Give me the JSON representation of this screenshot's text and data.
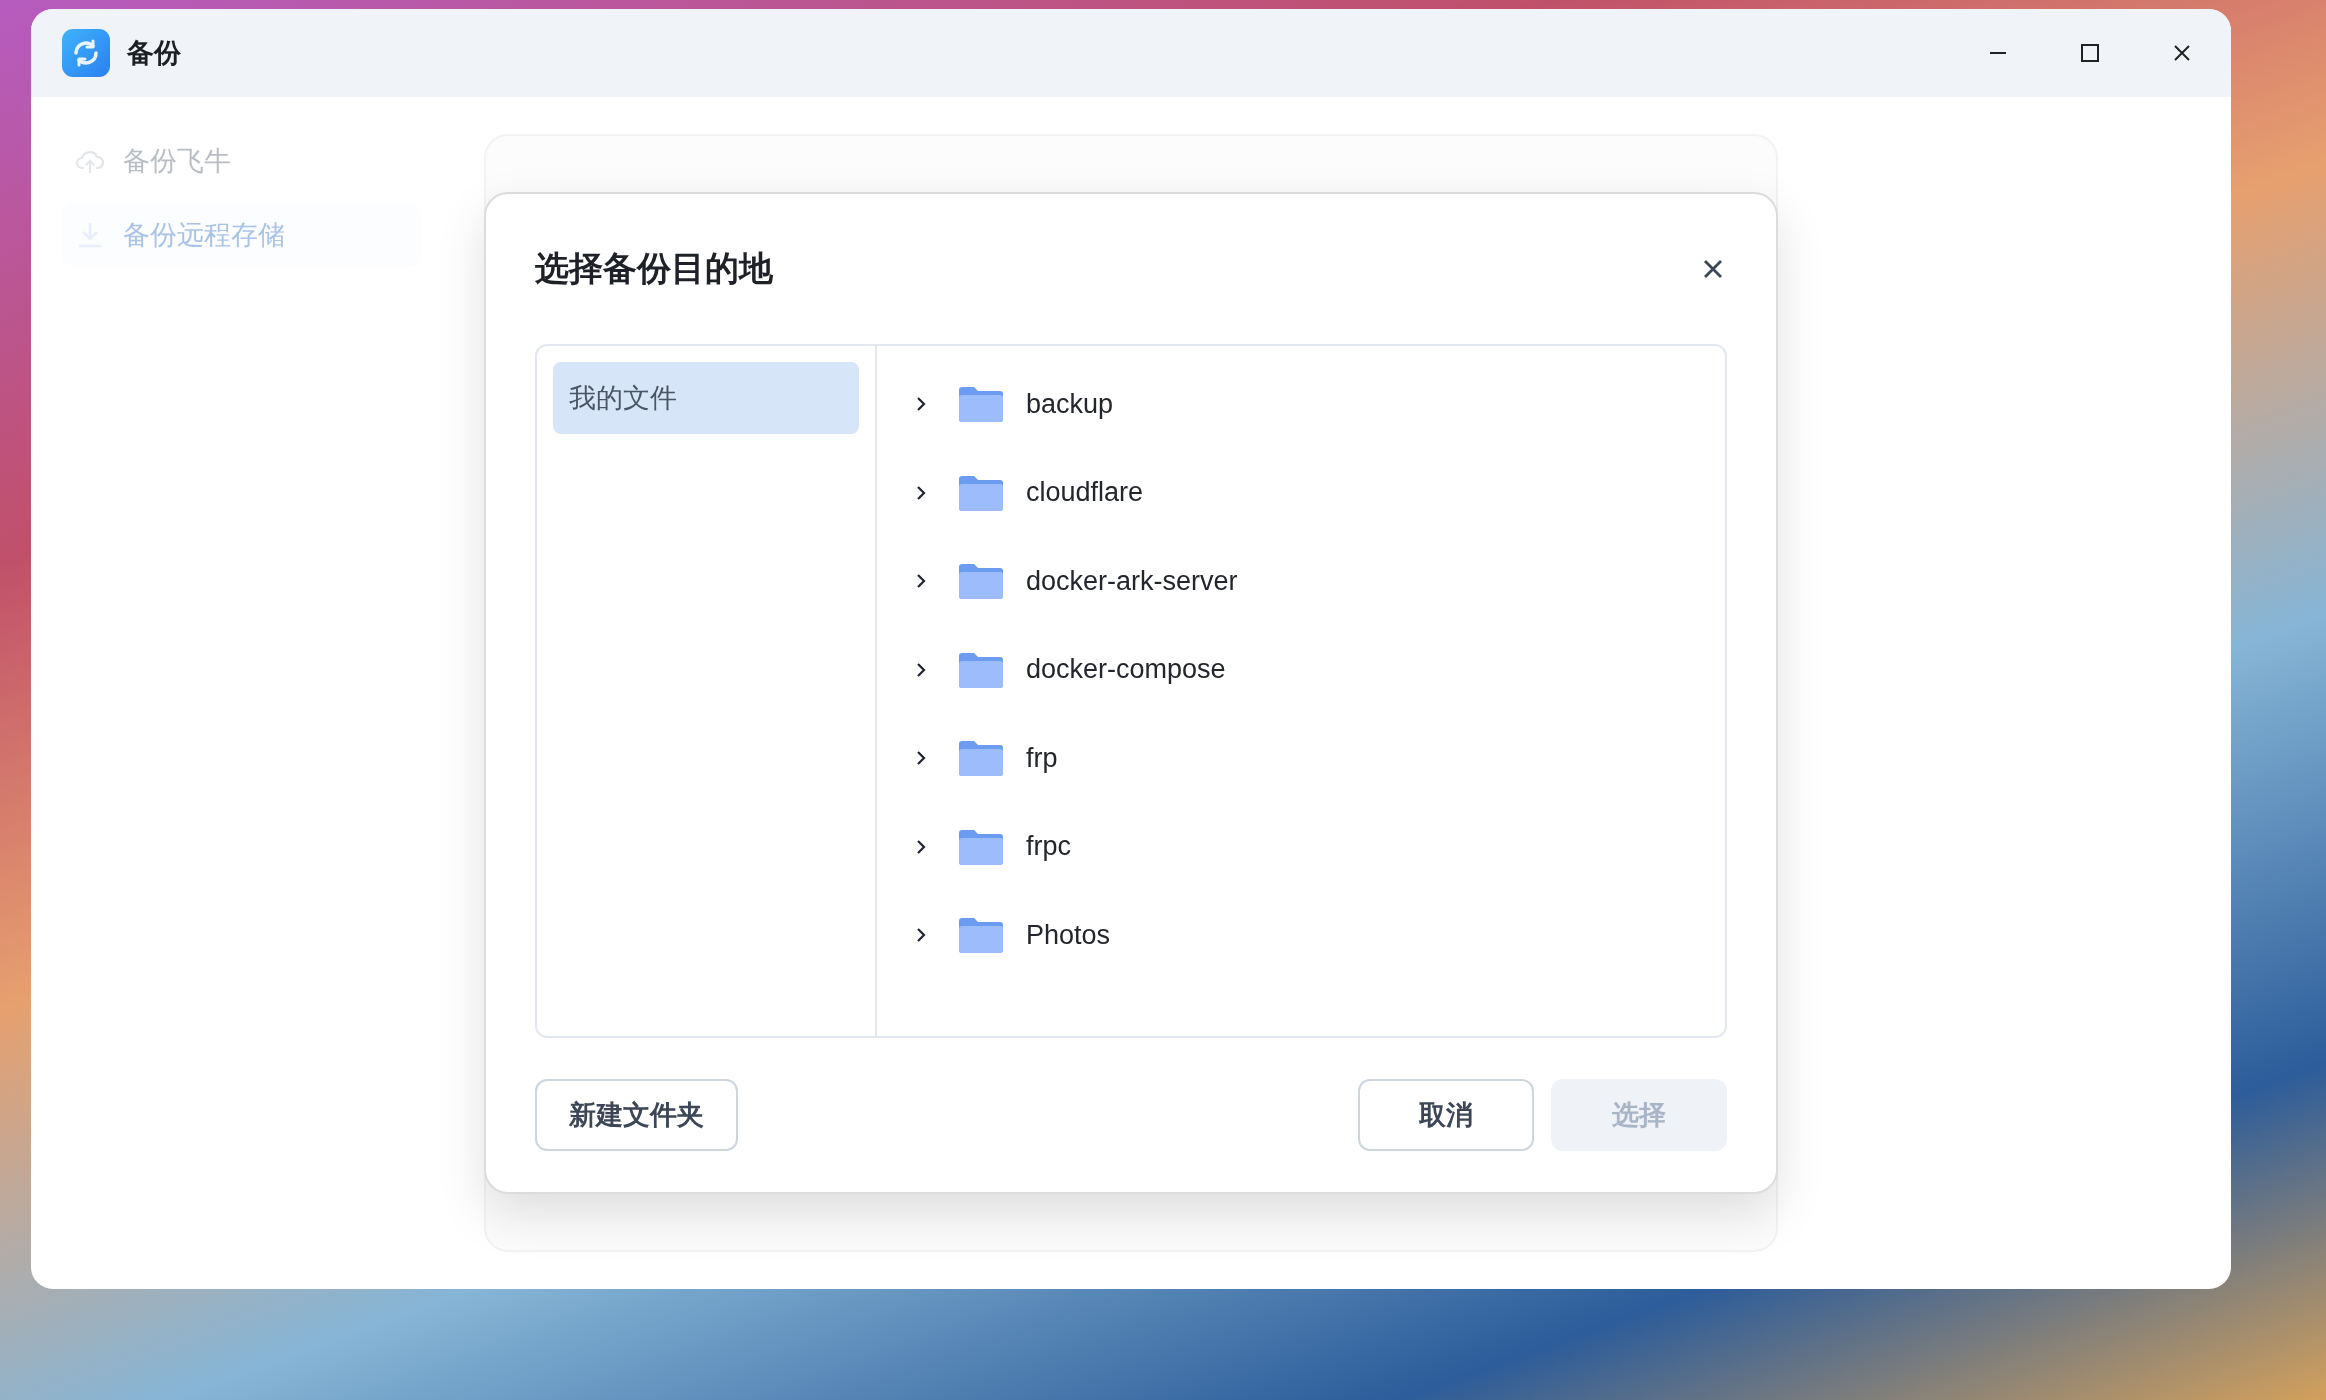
{
  "window": {
    "title": "备份"
  },
  "sidebar": {
    "items": [
      {
        "label": "备份飞牛",
        "selected": false
      },
      {
        "label": "备份远程存储",
        "selected": true
      }
    ]
  },
  "dialog": {
    "title": "选择备份目的地",
    "locations": [
      {
        "label": "我的文件",
        "selected": true
      }
    ],
    "folders": [
      {
        "name": "backup",
        "expanded": false
      },
      {
        "name": "cloudflare",
        "expanded": false
      },
      {
        "name": "docker-ark-server",
        "expanded": false
      },
      {
        "name": "docker-compose",
        "expanded": false
      },
      {
        "name": "frp",
        "expanded": false
      },
      {
        "name": "frpc",
        "expanded": false
      },
      {
        "name": "Photos",
        "expanded": false
      }
    ],
    "buttons": [
      {
        "label": "新建文件夹",
        "kind": "secondary",
        "disabled": false
      },
      {
        "label": "取消",
        "kind": "secondary",
        "disabled": false
      },
      {
        "label": "选择",
        "kind": "primary",
        "disabled": true
      }
    ]
  }
}
